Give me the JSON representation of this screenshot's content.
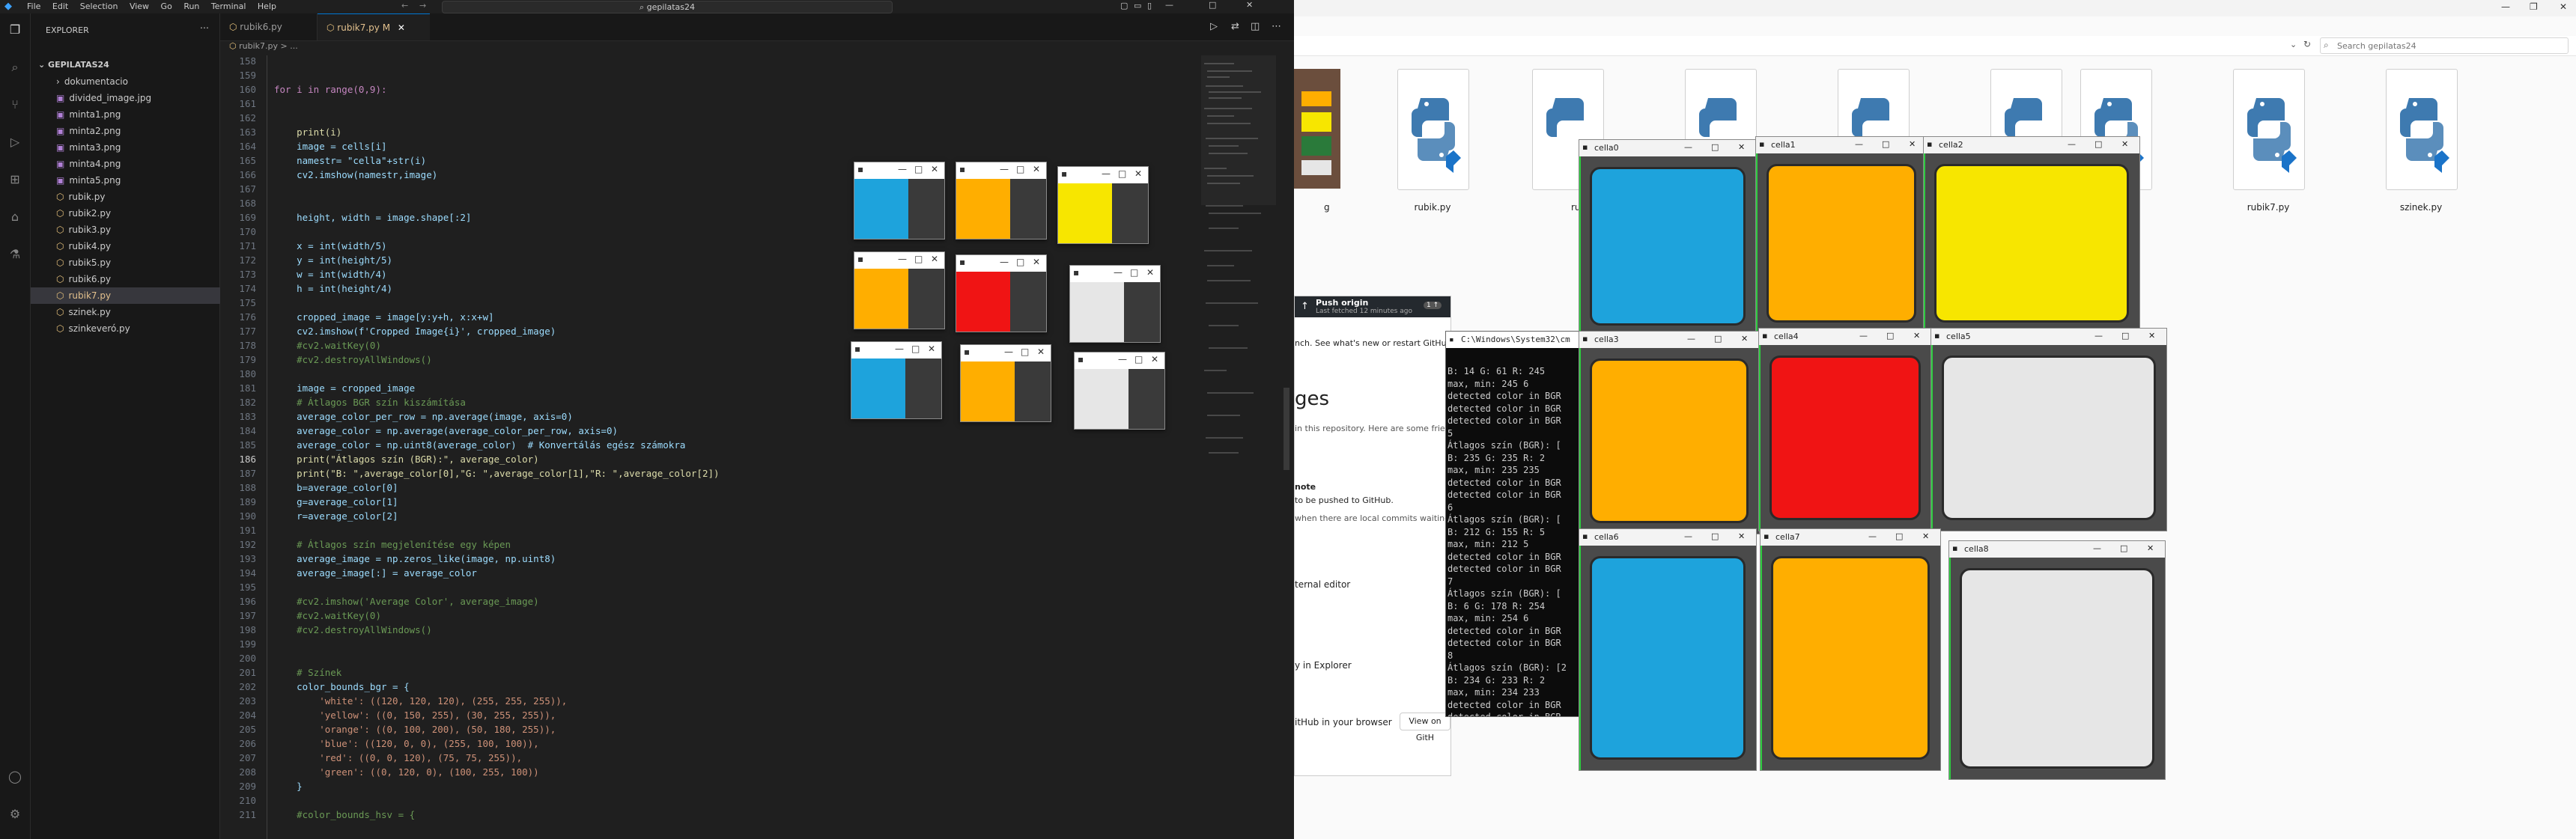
{
  "vscode": {
    "menu": [
      "File",
      "Edit",
      "Selection",
      "View",
      "Go",
      "Run",
      "Terminal",
      "Help"
    ],
    "search": "gepilatas24",
    "explorer_title": "EXPLORER",
    "folder": "GEPILATAS24",
    "files": [
      {
        "name": "dokumentacio",
        "badge": ""
      },
      {
        "name": "divided_image.jpg",
        "badge": ""
      },
      {
        "name": "minta1.png",
        "badge": ""
      },
      {
        "name": "minta2.png",
        "badge": ""
      },
      {
        "name": "minta3.png",
        "badge": ""
      },
      {
        "name": "minta4.png",
        "badge": ""
      },
      {
        "name": "minta5.png",
        "badge": ""
      },
      {
        "name": "rubik.py",
        "badge": ""
      },
      {
        "name": "rubik2.py",
        "badge": ""
      },
      {
        "name": "rubik3.py",
        "badge": ""
      },
      {
        "name": "rubik4.py",
        "badge": ""
      },
      {
        "name": "rubik5.py",
        "badge": ""
      },
      {
        "name": "rubik6.py",
        "badge": ""
      },
      {
        "name": "rubik7.py",
        "badge": "M"
      },
      {
        "name": "szinek.py",
        "badge": ""
      },
      {
        "name": "szinkeveró.py",
        "badge": ""
      }
    ],
    "tabs": [
      {
        "label": "rubik6.py",
        "active": false
      },
      {
        "label": "rubik7.py M",
        "active": true
      }
    ],
    "breadcrumb": "rubik7.py > ...",
    "code_lines": [
      {
        "n": "158",
        "t": ""
      },
      {
        "n": "159",
        "t": ""
      },
      {
        "n": "160",
        "t": "for i in range(0,9):"
      },
      {
        "n": "161",
        "t": ""
      },
      {
        "n": "162",
        "t": ""
      },
      {
        "n": "163",
        "t": "    print(i)"
      },
      {
        "n": "164",
        "t": "    image = cells[i]"
      },
      {
        "n": "165",
        "t": "    namestr= \"cella\"+str(i)"
      },
      {
        "n": "166",
        "t": "    cv2.imshow(namestr,image)"
      },
      {
        "n": "167",
        "t": ""
      },
      {
        "n": "168",
        "t": ""
      },
      {
        "n": "169",
        "t": "    height, width = image.shape[:2]"
      },
      {
        "n": "170",
        "t": ""
      },
      {
        "n": "171",
        "t": "    x = int(width/5)"
      },
      {
        "n": "172",
        "t": "    y = int(height/5)"
      },
      {
        "n": "173",
        "t": "    w = int(width/4)"
      },
      {
        "n": "174",
        "t": "    h = int(height/4)"
      },
      {
        "n": "175",
        "t": ""
      },
      {
        "n": "176",
        "t": "    cropped_image = image[y:y+h, x:x+w]"
      },
      {
        "n": "177",
        "t": "    cv2.imshow(f'Cropped Image{i}', cropped_image)"
      },
      {
        "n": "178",
        "t": "    #cv2.waitKey(0)"
      },
      {
        "n": "179",
        "t": "    #cv2.destroyAllWindows()"
      },
      {
        "n": "180",
        "t": ""
      },
      {
        "n": "181",
        "t": "    image = cropped_image"
      },
      {
        "n": "182",
        "t": "    # Átlagos BGR szín kiszámítása"
      },
      {
        "n": "183",
        "t": "    average_color_per_row = np.average(image, axis=0)"
      },
      {
        "n": "184",
        "t": "    average_color = np.average(average_color_per_row, axis=0)"
      },
      {
        "n": "185",
        "t": "    average_color = np.uint8(average_color)  # Konvertálás egész számokra"
      },
      {
        "n": "186",
        "t": "    print(\"Átlagos szín (BGR):\", average_color)"
      },
      {
        "n": "187",
        "t": "    print(\"B: \",average_color[0],\"G: \",average_color[1],\"R: \",average_color[2])"
      },
      {
        "n": "188",
        "t": "    b=average_color[0]"
      },
      {
        "n": "189",
        "t": "    g=average_color[1]"
      },
      {
        "n": "190",
        "t": "    r=average_color[2]"
      },
      {
        "n": "191",
        "t": ""
      },
      {
        "n": "192",
        "t": "    # Átlagos szín megjelenítése egy képen"
      },
      {
        "n": "193",
        "t": "    average_image = np.zeros_like(image, np.uint8)"
      },
      {
        "n": "194",
        "t": "    average_image[:] = average_color"
      },
      {
        "n": "195",
        "t": ""
      },
      {
        "n": "196",
        "t": "    #cv2.imshow('Average Color', average_image)"
      },
      {
        "n": "197",
        "t": "    #cv2.waitKey(0)"
      },
      {
        "n": "198",
        "t": "    #cv2.destroyAllWindows()"
      },
      {
        "n": "199",
        "t": ""
      },
      {
        "n": "200",
        "t": ""
      },
      {
        "n": "201",
        "t": "    # Színek"
      },
      {
        "n": "202",
        "t": "    color_bounds_bgr = {"
      },
      {
        "n": "203",
        "t": "        'white': ((120, 120, 120), (255, 255, 255)),"
      },
      {
        "n": "204",
        "t": "        'yellow': ((0, 150, 255), (30, 255, 255)),"
      },
      {
        "n": "205",
        "t": "        'orange': ((0, 100, 200), (50, 180, 255)),"
      },
      {
        "n": "206",
        "t": "        'blue': ((120, 0, 0), (255, 100, 100)),"
      },
      {
        "n": "207",
        "t": "        'red': ((0, 0, 120), (75, 75, 255)),"
      },
      {
        "n": "208",
        "t": "        'green': ((0, 120, 0), (100, 255, 100))"
      },
      {
        "n": "209",
        "t": "    }"
      },
      {
        "n": "210",
        "t": ""
      },
      {
        "n": "211",
        "t": "    #color_bounds_hsv = {"
      }
    ]
  },
  "small_windows": [
    {
      "color": "#1ea3dc"
    },
    {
      "color": "#ffae00"
    },
    {
      "color": "#f7e600"
    },
    {
      "color": "#ffae00"
    },
    {
      "color": "#f01414"
    },
    {
      "color": "#e6e6e6"
    },
    {
      "color": "#1ea3dc"
    },
    {
      "color": "#ffae00"
    },
    {
      "color": "#e6e6e6"
    }
  ],
  "file_explorer": {
    "search_placeholder": "Search gepilatas24",
    "files": [
      "rubik.py",
      "rubik6.py",
      "rubik7.py",
      "szinek.py"
    ],
    "partial_label_g": "g",
    "partial_label_rubi": "rubi"
  },
  "cell_windows": [
    {
      "title": "cella0",
      "color": "#1ea3dc"
    },
    {
      "title": "cella1",
      "color": "#ffae00"
    },
    {
      "title": "cella2",
      "color": "#f7e600"
    },
    {
      "title": "cella3",
      "color": "#ffae00"
    },
    {
      "title": "cella4",
      "color": "#f01414"
    },
    {
      "title": "cella5",
      "color": "#e6e6e6"
    },
    {
      "title": "cella6",
      "color": "#1ea3dc"
    },
    {
      "title": "cella7",
      "color": "#ffae00"
    },
    {
      "title": "cella8",
      "color": "#e6e6e6"
    }
  ],
  "github": {
    "push_title": "Push origin",
    "push_sub": "Last fetched 12 minutes ago",
    "push_badge": "1 ↑",
    "line1": "nch. See what's new or restart GitHub",
    "heading": "ges",
    "line2": "in this repository. Here are some frien",
    "note": "note",
    "note2": "to be pushed to GitHub.",
    "note3": "when there are local commits waiting to",
    "ext_editor": "ternal editor",
    "in_explorer": "y in Explorer",
    "in_browser": "itHub in your browser",
    "view_btn": "View on GitH"
  },
  "cmd": {
    "title": "C:\\Windows\\System32\\cm",
    "lines": [
      "B:  14 G:  61 R:  245",
      "max, min: 245 6",
      "detected color in BGR",
      "detected color in BGR",
      "detected color in BGR",
      "5",
      "Átlagos szín (BGR): [",
      "B:  235 G:  235 R:  2",
      "max, min: 235 235",
      "detected color in BGR",
      "detected color in BGR",
      "6",
      "Átlagos szín (BGR): [",
      "B:  212 G:  155 R:  5",
      "max, min: 212 5",
      "detected color in BGR",
      "detected color in BGR",
      "7",
      "Átlagos szín (BGR): [",
      "B:  6 G:  178 R:  254",
      "max, min: 254 6",
      "detected color in BGR",
      "detected color in BGR",
      "8",
      "Átlagos szín (BGR): [2",
      "B:  234 G:  233 R:  2",
      "max, min: 234 233",
      "detected color in BGR",
      "detected color in BGR"
    ]
  }
}
